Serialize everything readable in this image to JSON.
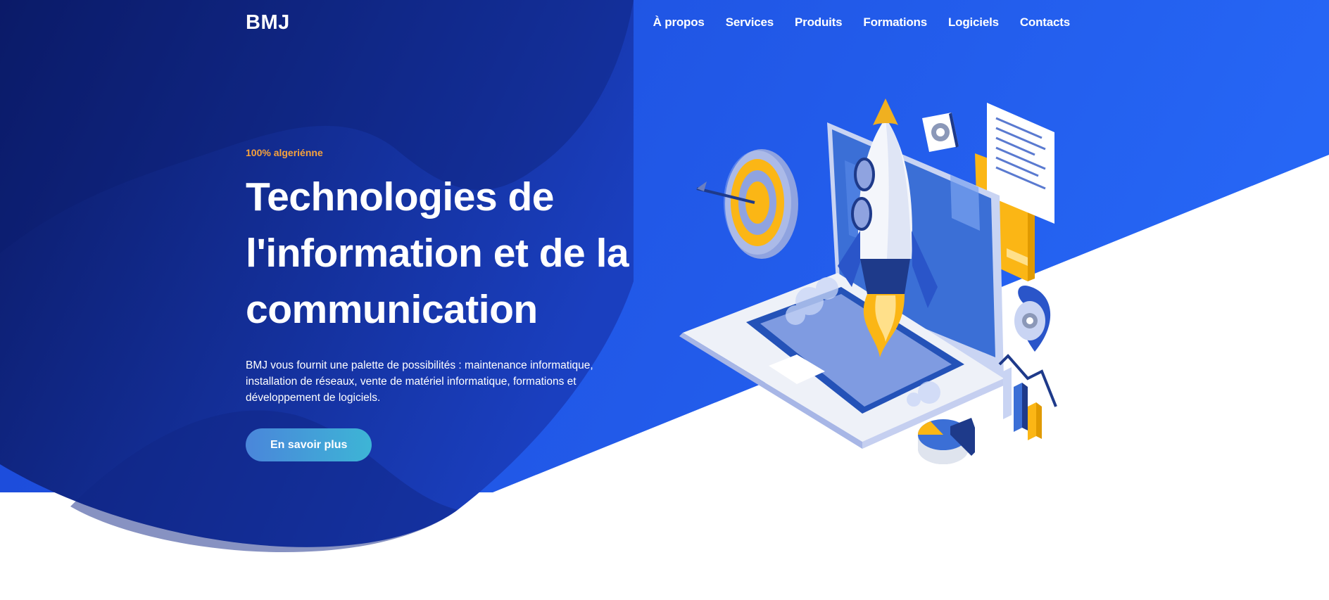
{
  "header": {
    "logo": "BMJ",
    "nav": [
      "À propos",
      "Services",
      "Produits",
      "Formations",
      "Logiciels",
      "Contacts"
    ]
  },
  "hero": {
    "tagline": "100% algeriénne",
    "title_lines": [
      "Technologies de",
      "l'information et de la",
      "communication"
    ],
    "description_lines": [
      "BMJ vous fournit une palette de possibilités : maintenance informatique,",
      "installation de réseaux, vente de matériel informatique, formations et",
      "développement de logiciels."
    ],
    "cta_label": "En savoir plus"
  },
  "colors": {
    "hero_dark": "#0e1f6e",
    "hero_bright": "#2160f0",
    "accent_orange": "#f7a23b",
    "rocket_yellow": "#fbb615"
  },
  "illustration": {
    "icons": [
      "target-icon",
      "gear-icon",
      "rocket-icon",
      "laptop-icon",
      "folder-icon",
      "document-icon",
      "location-pin-icon",
      "bar-chart-icon",
      "pie-chart-icon"
    ]
  }
}
